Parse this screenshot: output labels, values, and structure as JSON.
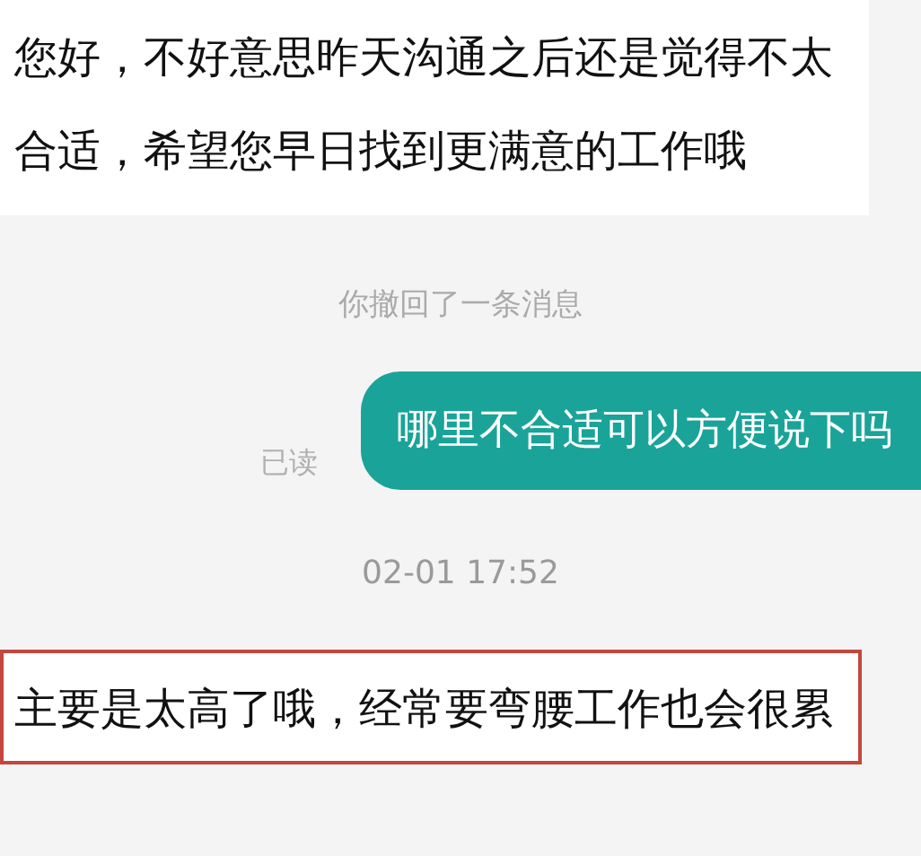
{
  "messages": [
    {
      "kind": "incoming",
      "text": "您好，不好意思昨天沟通之后还是觉得不太合适，希望您早日找到更满意的工作哦",
      "highlighted": false
    },
    {
      "kind": "notice",
      "text": "你撤回了一条消息"
    },
    {
      "kind": "outgoing",
      "text": "哪里不合适可以方便说下吗",
      "read_label": "已读"
    },
    {
      "kind": "timestamp",
      "text": "02-01 17:52"
    },
    {
      "kind": "incoming",
      "text": "主要是太高了哦，经常要弯腰工作也会很累",
      "highlighted": true
    }
  ]
}
